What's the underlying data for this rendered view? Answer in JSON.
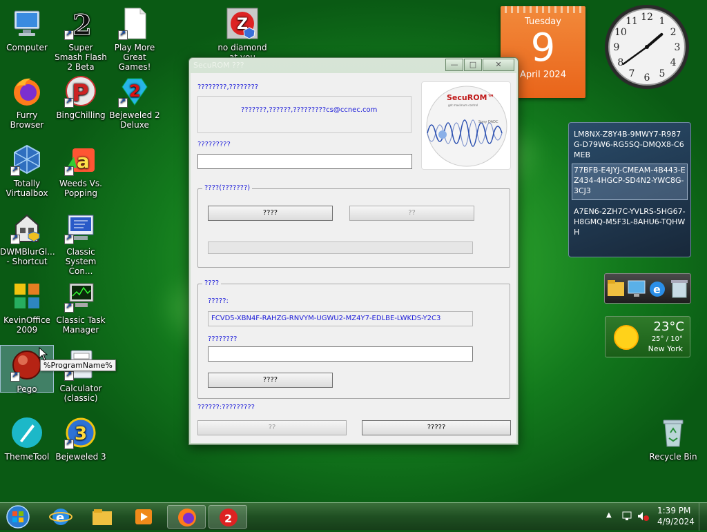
{
  "desktop": {
    "icons": [
      {
        "label": "Computer"
      },
      {
        "label": "Super Smash Flash 2 Beta"
      },
      {
        "label": "Play More Great Games!"
      },
      {
        "label": "no diamond at you"
      },
      {
        "label": "Furry Browser"
      },
      {
        "label": "BingChilling"
      },
      {
        "label": "Bejeweled 2 Deluxe"
      },
      {
        "label": "Totally Virtualbox"
      },
      {
        "label": "Weeds Vs. Popping"
      },
      {
        "label": "DWMBlurGl... - Shortcut"
      },
      {
        "label": "Classic System Con..."
      },
      {
        "label": "KevinOffice 2009"
      },
      {
        "label": "Classic Task Manager"
      },
      {
        "label": "Pego"
      },
      {
        "label": "Calculator (classic)"
      },
      {
        "label": "ThemeTool"
      },
      {
        "label": "Bejeweled 3"
      },
      {
        "label": "Recycle Bin"
      }
    ],
    "tooltip": "%ProgramName%"
  },
  "window": {
    "title": "SecuROM ???",
    "contact_label": "????????,????????",
    "contact_text": "???????,??????,?????????cs@ccnec.com",
    "name_label": "?????????",
    "name_value": "",
    "logo_text": "SecuROM™",
    "logo_tagline": "get maximum control",
    "logo_brand": "Sony DADC",
    "group1": {
      "label": "????(???????)",
      "btn_left": "????",
      "btn_right": "??",
      "progress": 0
    },
    "group2": {
      "label": "????",
      "code_label": "?????:",
      "code_value": "FCVD5-XBN4F-RAHZG-RNVYM-UGWU2-MZ4Y7-EDLBE-LWKDS-Y2C3",
      "unlock_label": "????????",
      "unlock_value": "",
      "btn": "????"
    },
    "footer_label": "??????:?????????",
    "btn_bottom_left": "??",
    "btn_bottom_right": "?????"
  },
  "calendar": {
    "weekday": "Tuesday",
    "day": "9",
    "month_year": "April 2024"
  },
  "clock": {
    "hour": 1,
    "minute": 39
  },
  "keys": [
    "LM8NX-Z8Y4B-9MWY7-R987G-D79W6-RG5SQ-DMQX8-C6MEB",
    "77BFB-E4JYJ-CMEAM-4B443-EZ434-4HGCP-SD4N2-YWC8G-3CJ3",
    "A7EN6-2ZH7C-YVLRS-5HG67-H8GMQ-M5F3L-8AHU6-TQHWH"
  ],
  "weather": {
    "temp": "23°C",
    "range": "25° / 10°",
    "city": "New York"
  },
  "taskbar": {
    "time": "1:39 PM",
    "date": "4/9/2024"
  },
  "colors": {
    "accent_label": "#1a1ad8",
    "calendar": "#ee7128"
  }
}
